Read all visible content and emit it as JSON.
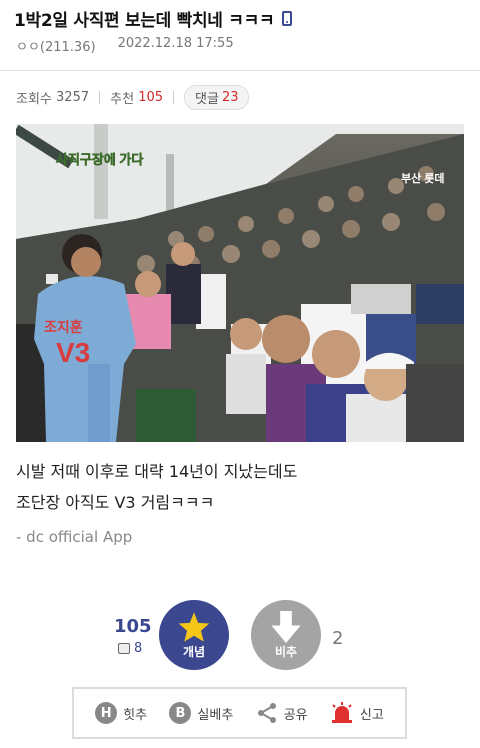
{
  "post": {
    "title": "1박2일 사직편 보는데 빡치네 ㅋㅋㅋ",
    "author": "ㅇㅇ(211.36)",
    "date": "2022.12.18 17:55"
  },
  "stats": {
    "views_label": "조회수",
    "views": "3257",
    "recommend_label": "추천",
    "recommend": "105",
    "comments_label": "댓글",
    "comments": "23"
  },
  "image": {
    "caption_overlay": "사직구장에 가다",
    "sign_text": "부산 롯데",
    "jersey_name": "조지훈",
    "jersey_number": "V3"
  },
  "content": {
    "line1": "시발 저때 이후로 대략 14년이 지났는데도",
    "line2": "조단장 아직도 V3 거림ㅋㅋㅋ",
    "signature": "- dc official App"
  },
  "vote": {
    "up_count": "105",
    "sub_count": "8",
    "up_label": "개념",
    "down_label": "비추",
    "down_count": "2"
  },
  "actions": {
    "hit_label": "힛추",
    "best_label": "실베추",
    "share_label": "공유",
    "report_label": "신고"
  },
  "colors": {
    "accent": "#3b4890",
    "red": "#d42a2a",
    "star": "#f5c518",
    "grey_button": "#a4a4a4"
  }
}
